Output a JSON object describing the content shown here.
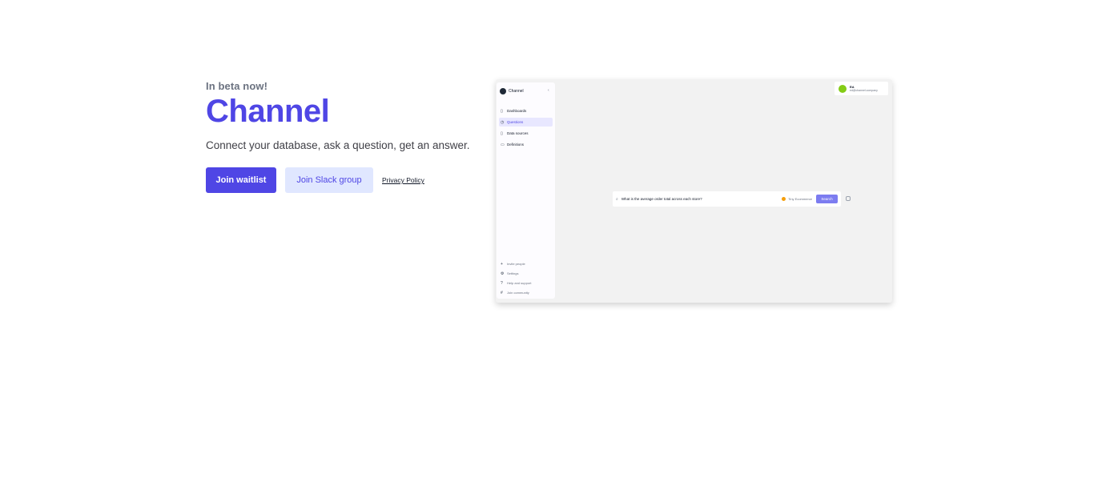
{
  "hero": {
    "eyebrow": "In beta now!",
    "title": "Channel",
    "subtitle": "Connect your database, ask a question, get an answer.",
    "join_waitlist_label": "Join waitlist",
    "join_slack_label": "Join Slack group",
    "privacy_label": "Privacy Policy"
  },
  "preview": {
    "brand": "Channel",
    "collapse_glyph": "‹",
    "nav": [
      {
        "icon": "dashboard-icon",
        "glyph": "▯",
        "label": "Dashboards"
      },
      {
        "icon": "question-icon",
        "glyph": "◷",
        "label": "Questions",
        "active": true
      },
      {
        "icon": "data-icon",
        "glyph": "▯",
        "label": "Data sources"
      },
      {
        "icon": "definitions-icon",
        "glyph": "▭",
        "label": "Definitions"
      }
    ],
    "bottom": [
      {
        "icon": "plus-icon",
        "glyph": "+",
        "label": "Invite people"
      },
      {
        "icon": "settings-icon",
        "glyph": "⚙",
        "label": "Settings"
      },
      {
        "icon": "help-icon",
        "glyph": "?",
        "label": "Help and support"
      },
      {
        "icon": "slack-icon",
        "glyph": "#",
        "label": "Join community"
      }
    ],
    "user": {
      "name": "Ed.",
      "email": "ed@channel.company"
    },
    "search": {
      "query": "What is the average order total across each store?",
      "database": "Tiny Ecommerce",
      "button": "Search"
    },
    "colors": {
      "accent": "#4f46e5",
      "accent_soft": "#e0e7ff",
      "avatar": "#84cc16"
    }
  }
}
